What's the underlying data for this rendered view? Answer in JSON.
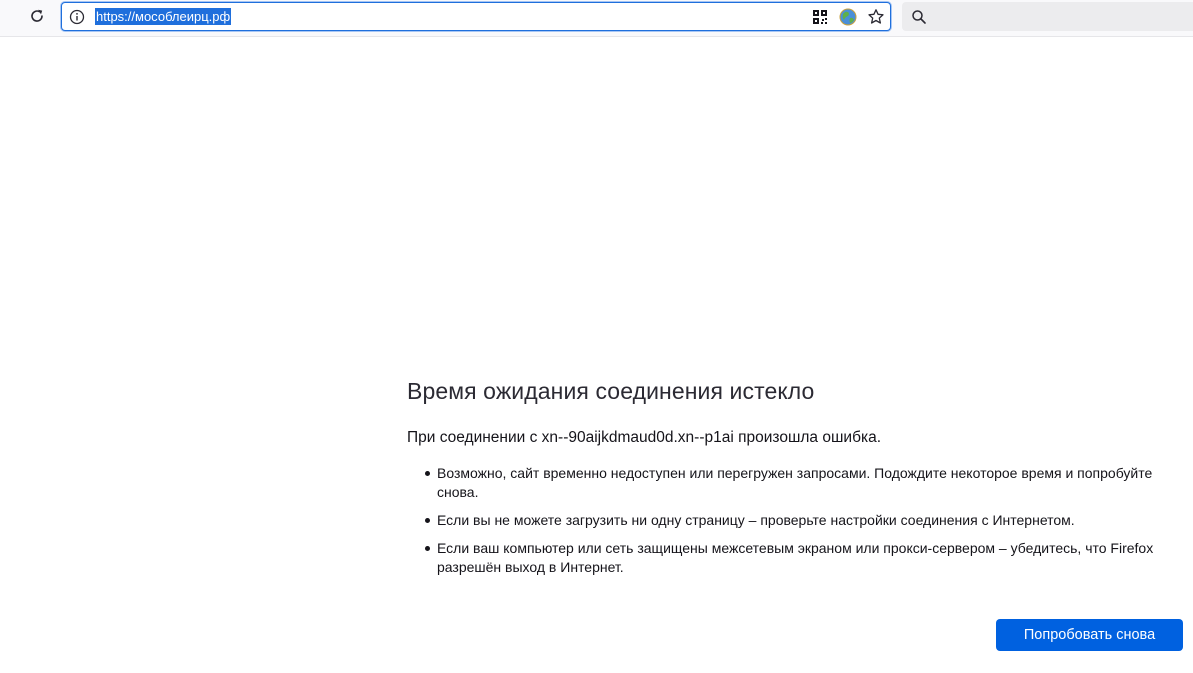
{
  "toolbar": {
    "url": "https://мособлеирц.рф",
    "icons": [
      "reload-icon",
      "info-icon",
      "qr-code-icon",
      "globe-icon",
      "bookmark-star-icon",
      "search-icon"
    ]
  },
  "error": {
    "title": "Время ожидания соединения истекло",
    "subtitle": "При соединении с xn--90aijkdmaud0d.xn--p1ai произошла ошибка.",
    "items": [
      "Возможно, сайт временно недоступен или перегружен запросами. Подождите некоторое время и попробуйте снова.",
      "Если вы не можете загрузить ни одну страницу – проверьте настройки соединения с Интернетом.",
      "Если ваш компьютер или сеть защищены межсетевым экраном или прокси-сервером – убедитесь, что Firefox разрешён выход в Интернет."
    ],
    "retry_label": "Попробовать снова"
  },
  "colors": {
    "accent": "#0061e0",
    "url_highlight": "#1f6fdc"
  }
}
